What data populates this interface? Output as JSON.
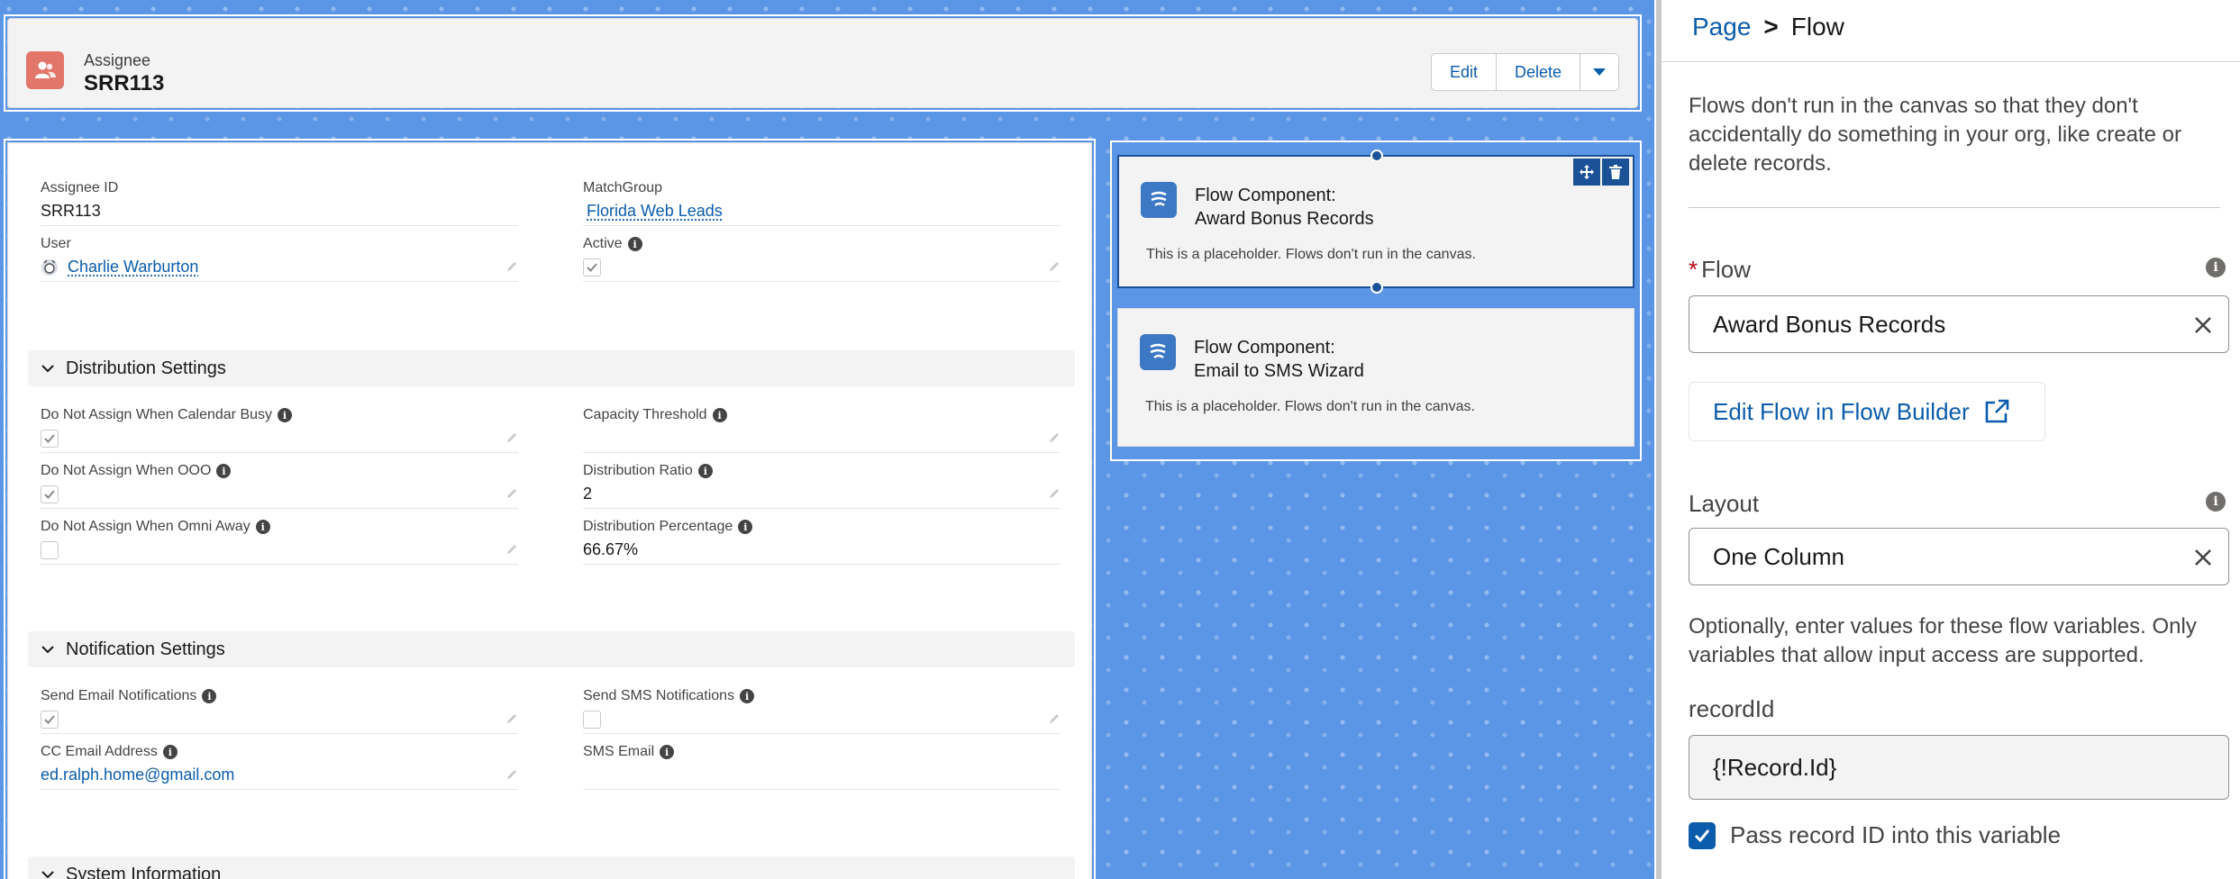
{
  "colors": {
    "canvas_blue": "#5b95e6",
    "link_blue": "#0b5cab",
    "record_icon": "#e3766b",
    "selected_border": "#1b5297"
  },
  "header": {
    "object_label": "Assignee",
    "record_name": "SRR113",
    "icon": "user-group-icon",
    "buttons": {
      "edit": "Edit",
      "delete": "Delete"
    }
  },
  "detail": {
    "fields_top": [
      {
        "label": "Assignee ID",
        "value": "SRR113"
      },
      {
        "label": "MatchGroup",
        "value": "Florida Web Leads"
      },
      {
        "label": "User",
        "value": "Charlie Warburton"
      },
      {
        "label": "Active",
        "value": ""
      }
    ],
    "distribution": {
      "title": "Distribution Settings",
      "fields": [
        {
          "label": "Do Not Assign When Calendar Busy",
          "value": ""
        },
        {
          "label": "Capacity Threshold",
          "value": ""
        },
        {
          "label": "Do Not Assign When OOO",
          "value": ""
        },
        {
          "label": "Distribution Ratio",
          "value": "2"
        },
        {
          "label": "Do Not Assign When Omni Away",
          "value": ""
        },
        {
          "label": "Distribution Percentage",
          "value": "66.67%"
        }
      ]
    },
    "notification": {
      "title": "Notification Settings",
      "fields": [
        {
          "label": "Send Email Notifications",
          "value": ""
        },
        {
          "label": "Send SMS Notifications",
          "value": ""
        },
        {
          "label": "CC Email Address",
          "value": "ed.ralph.home@gmail.com"
        },
        {
          "label": "SMS Email",
          "value": ""
        }
      ]
    },
    "system": {
      "title": "System Information"
    }
  },
  "flow_components": [
    {
      "title_line1": "Flow Component:",
      "title_line2": "Award Bonus Records",
      "desc": "This is a placeholder. Flows don't run in the canvas."
    },
    {
      "title_line1": "Flow Component:",
      "title_line2": "Email to SMS Wizard",
      "desc": "This is a placeholder. Flows don't run in the canvas."
    }
  ],
  "panel": {
    "breadcrumb": {
      "parent": "Page",
      "separator": ">",
      "current": "Flow"
    },
    "intro": "Flows don't run in the canvas so that they don't accidentally do something in your org, like create or delete records.",
    "flow_label": "Flow",
    "flow_required_mark": "*",
    "flow_value": "Award Bonus Records",
    "edit_flow_button": "Edit Flow in Flow Builder",
    "layout_label": "Layout",
    "layout_value": "One Column",
    "optional_text": "Optionally, enter values for these flow variables. Only variables that allow input access are supported.",
    "record_id_label": "recordId",
    "record_id_value": "{!Record.Id}",
    "pass_record_label": "Pass record ID into this variable"
  }
}
